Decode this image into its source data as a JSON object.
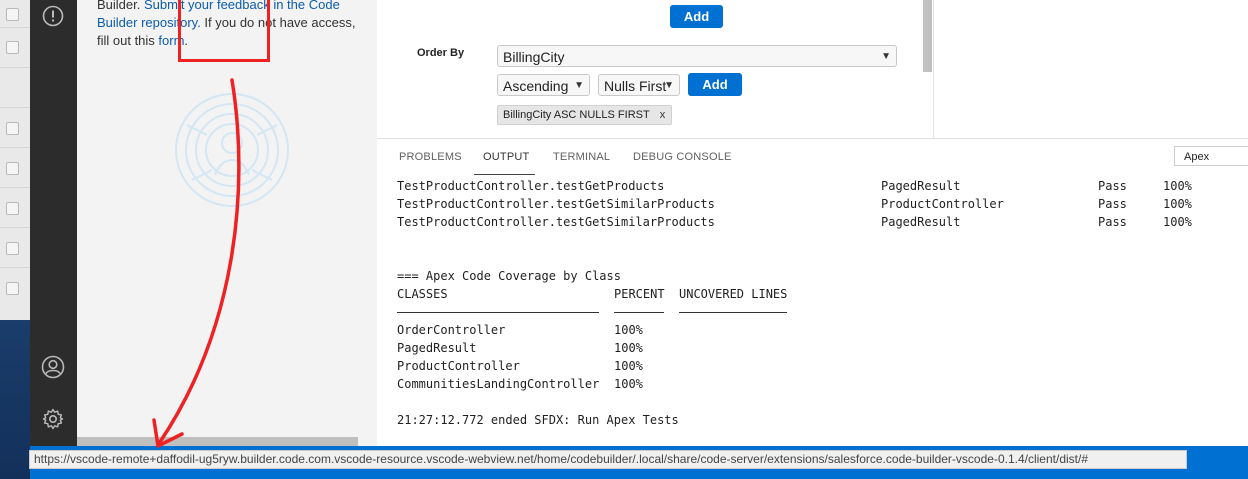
{
  "sidebar": {
    "text_start": "Builder. ",
    "feedback_link": "Submit your feedback in the Code Builder repository.",
    "text_mid": " If you do not have access, fill out this ",
    "form_link": "form",
    "text_end": "."
  },
  "webview": {
    "add_top_label": "Add",
    "order_by_label": "Order By",
    "order_field": "BillingCity",
    "direction": "Ascending",
    "nulls": "Nulls First",
    "add_label": "Add",
    "order_pill": "BillingCity ASC NULLS FIRST",
    "pill_remove": "x"
  },
  "panel": {
    "tabs": [
      "PROBLEMS",
      "OUTPUT",
      "TERMINAL",
      "DEBUG CONSOLE"
    ],
    "active_tab": "OUTPUT",
    "channel": "Apex",
    "results": [
      {
        "test": "TestProductController.testGetProducts",
        "class": "PagedResult",
        "outcome": "Pass",
        "pct": "100%"
      },
      {
        "test": "TestProductController.testGetSimilarProducts",
        "class": "ProductController",
        "outcome": "Pass",
        "pct": "100%"
      },
      {
        "test": "TestProductController.testGetSimilarProducts",
        "class": "PagedResult",
        "outcome": "Pass",
        "pct": "100%"
      }
    ],
    "coverage_title": "=== Apex Code Coverage by Class",
    "coverage_headers": [
      "CLASSES",
      "PERCENT",
      "UNCOVERED LINES"
    ],
    "coverage_rows": [
      {
        "cls": "OrderController",
        "pct": "100%"
      },
      {
        "cls": "PagedResult",
        "pct": "100%"
      },
      {
        "cls": "ProductController",
        "pct": "100%"
      },
      {
        "cls": "CommunitiesLandingController",
        "pct": "100%"
      }
    ],
    "ended_line": "21:27:12.772 ended SFDX: Run Apex Tests"
  },
  "status": {
    "url": "https://vscode-remote+daffodil-ug5ryw.builder.code.com.vscode-resource.vscode-webview.net/home/codebuilder/.local/share/code-server/extensions/salesforce.code-builder-vscode-0.1.4/client/dist/#"
  },
  "colors": {
    "accent": "#0070d2",
    "activity_bar": "#2c2c2c",
    "annotation": "#ee2222"
  }
}
